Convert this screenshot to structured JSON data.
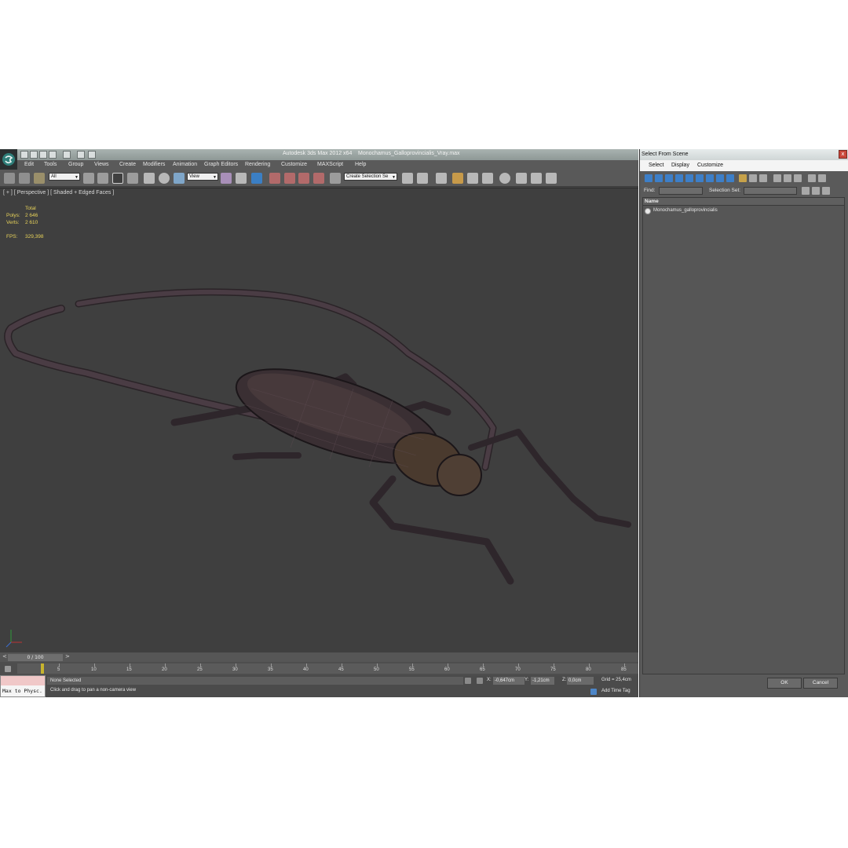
{
  "window": {
    "title": "Autodesk 3ds Max  2012 x64",
    "file": "Monochamus_Galloprovincialis_Vray.max"
  },
  "menu": [
    "Edit",
    "Tools",
    "Group",
    "Views",
    "Create",
    "Modifiers",
    "Animation",
    "Graph Editors",
    "Rendering",
    "Customize",
    "MAXScript",
    "Help"
  ],
  "toolbar": {
    "selection_filter": "All",
    "reference_coord": "View",
    "named_selection": "Create Selection Se"
  },
  "viewport": {
    "label": "[ + ] [ Perspective ] [ Shaded + Edged Faces ]",
    "stats_header": "Total",
    "polys_label": "Polys:",
    "polys_value": "2 646",
    "verts_label": "Verts:",
    "verts_value": "2 610",
    "fps_label": "FPS:",
    "fps_value": "329,398"
  },
  "timeline": {
    "counter": "0 / 100",
    "prev": "<",
    "next": ">",
    "frame_ticks": [
      "5",
      "10",
      "15",
      "20",
      "25",
      "30",
      "35",
      "40",
      "45",
      "50",
      "55",
      "60",
      "65",
      "70",
      "75",
      "80",
      "85"
    ]
  },
  "status": {
    "script_listener": "Max to Physc.",
    "selection": "None Selected",
    "prompt": "Click and drag to pan a non-camera view",
    "x_label": "X:",
    "x_value": "-0,647cm",
    "y_label": "Y:",
    "y_value": "-1,21cm",
    "z_label": "Z:",
    "z_value": "0,0cm",
    "grid": "Grid = 25,4cm",
    "add_time_tag": "Add Time Tag"
  },
  "dialog": {
    "title": "Select From Scene",
    "close": "x",
    "menu": [
      "Select",
      "Display",
      "Customize"
    ],
    "find_label": "Find:",
    "selection_set_label": "Selection Set:",
    "column_header": "Name",
    "objects": [
      "Monochamus_galloprovincialis"
    ],
    "ok": "OK",
    "cancel": "Cancel"
  },
  "colors": {
    "viewport_bg": "#3f3f3f",
    "stats_text": "#e8d35a",
    "insect_body": "#3a2f33"
  }
}
